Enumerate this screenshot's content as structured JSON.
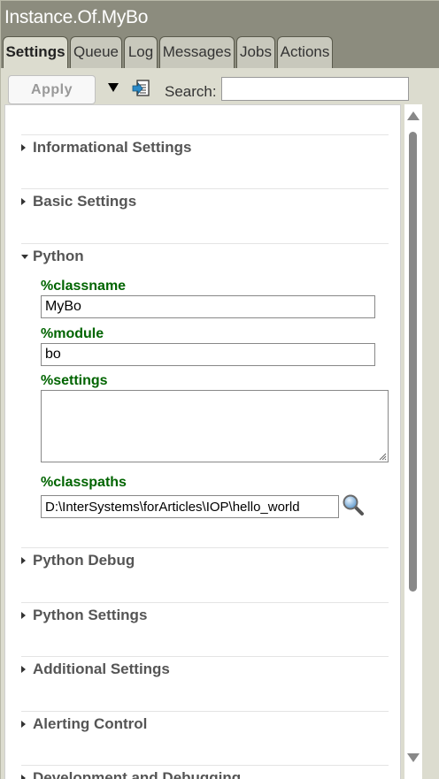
{
  "window": {
    "title": "Instance.Of.MyBo"
  },
  "tabs": [
    {
      "label": "Settings",
      "active": true
    },
    {
      "label": "Queue"
    },
    {
      "label": "Log"
    },
    {
      "label": "Messages"
    },
    {
      "label": "Jobs"
    },
    {
      "label": "Actions"
    }
  ],
  "toolbar": {
    "apply_label": "Apply",
    "search_label": "Search:",
    "search_value": "",
    "icons": [
      "dropdown-triangle-icon",
      "settings-document-icon"
    ]
  },
  "sections": [
    {
      "label": "Informational Settings",
      "expanded": false
    },
    {
      "label": "Basic Settings",
      "expanded": false
    },
    {
      "label": "Python",
      "expanded": true
    },
    {
      "label": "Python Debug",
      "expanded": false
    },
    {
      "label": "Python Settings",
      "expanded": false
    },
    {
      "label": "Additional Settings",
      "expanded": false
    },
    {
      "label": "Alerting Control",
      "expanded": false
    },
    {
      "label": "Development and Debugging",
      "expanded": false
    }
  ],
  "python": {
    "classname": {
      "label": "%classname",
      "value": "MyBo"
    },
    "module": {
      "label": "%module",
      "value": "bo"
    },
    "settings": {
      "label": "%settings",
      "value": ""
    },
    "classpaths": {
      "label": "%classpaths",
      "value": "D:\\InterSystems\\forArticles\\IOP\\hello_world"
    }
  },
  "colors": {
    "titlebar": "#8c8c7e",
    "content_bg": "#dcdccf",
    "field_label": "#006400",
    "section_label": "#555555"
  }
}
